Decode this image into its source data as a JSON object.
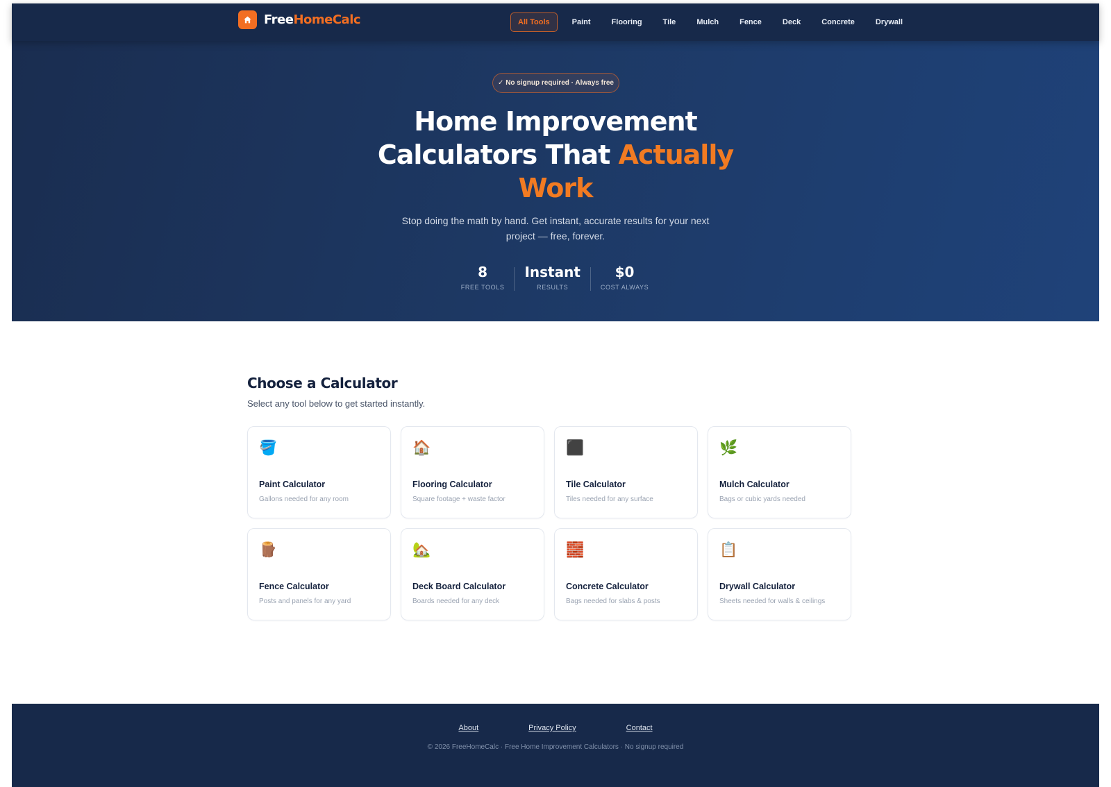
{
  "brand": {
    "name_part1": "Free",
    "name_part2": "HomeCalc",
    "accent_color": "#f26e22",
    "navy_color": "#17294a",
    "logo_icon": "home-icon"
  },
  "nav": {
    "items": [
      {
        "label": "All Tools",
        "active": true
      },
      {
        "label": "Paint"
      },
      {
        "label": "Flooring"
      },
      {
        "label": "Tile"
      },
      {
        "label": "Mulch"
      },
      {
        "label": "Fence"
      },
      {
        "label": "Deck"
      },
      {
        "label": "Concrete"
      },
      {
        "label": "Drywall"
      }
    ]
  },
  "hero": {
    "badge": "✓ No signup required · Always free",
    "title_line1": "Home Improvement",
    "title_line2_a": "Calculators That ",
    "title_line2_b": "Actually",
    "title_line3": "Work",
    "subtitle": "Stop doing the math by hand. Get instant, accurate results for your next project — free, forever.",
    "stats": [
      {
        "value": "8",
        "label": "FREE TOOLS"
      },
      {
        "value": "Instant",
        "label": "RESULTS"
      },
      {
        "value": "$0",
        "label": "COST ALWAYS"
      }
    ]
  },
  "main": {
    "title": "Choose a Calculator",
    "subtitle": "Select any tool below to get started instantly.",
    "cards": [
      {
        "icon": "paint-bucket-icon",
        "glyph": "🪣",
        "title": "Paint Calculator",
        "desc": "Gallons needed for any room"
      },
      {
        "icon": "house-icon",
        "glyph": "🏠",
        "title": "Flooring Calculator",
        "desc": "Square footage + waste factor"
      },
      {
        "icon": "tile-square-icon",
        "glyph": "⬛",
        "title": "Tile Calculator",
        "desc": "Tiles needed for any surface"
      },
      {
        "icon": "herb-icon",
        "glyph": "🌿",
        "title": "Mulch Calculator",
        "desc": "Bags or cubic yards needed"
      },
      {
        "icon": "wood-log-icon",
        "glyph": "🪵",
        "title": "Fence Calculator",
        "desc": "Posts and panels for any yard"
      },
      {
        "icon": "house-garden-icon",
        "glyph": "🏡",
        "title": "Deck Board Calculator",
        "desc": "Boards needed for any deck"
      },
      {
        "icon": "brick-icon",
        "glyph": "🧱",
        "title": "Concrete Calculator",
        "desc": "Bags needed for slabs & posts"
      },
      {
        "icon": "clipboard-icon",
        "glyph": "📋",
        "title": "Drywall Calculator",
        "desc": "Sheets needed for walls & ceilings"
      }
    ]
  },
  "footer": {
    "links": [
      "About",
      "Privacy Policy",
      "Contact"
    ],
    "copyright": "© 2026 FreeHomeCalc · Free Home Improvement Calculators · No signup required"
  }
}
